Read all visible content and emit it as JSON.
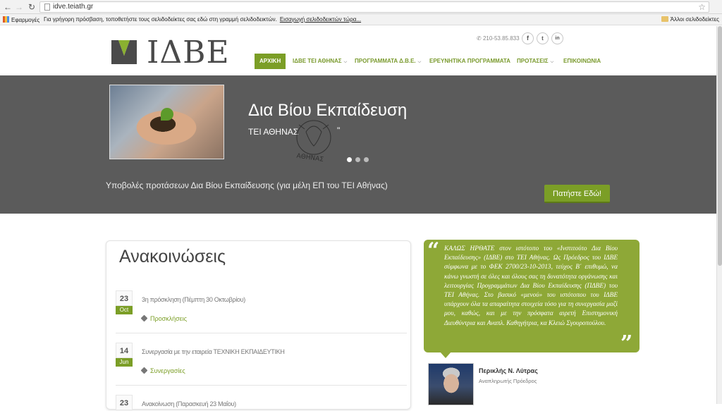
{
  "browser": {
    "url": "idve.teiath.gr",
    "bookmarks_apps_label": "Εφαρμογές",
    "bookmarks_hint": "Για γρήγορη πρόσβαση, τοποθετήστε τους σελιδοδείκτες σας εδώ στη γραμμή σελιδοδεικτών.",
    "bookmarks_import_link": "Εισαγωγή σελιδοδεικτών τώρα...",
    "other_bookmarks": "Άλλοι σελιδοδείκτες"
  },
  "header": {
    "logo_text": "ΙΔΒΕ",
    "phone": "210-53.85.833",
    "social": [
      "f",
      "t",
      "in"
    ],
    "menu": [
      {
        "label": "ΑΡΧΙΚΗ",
        "active": true
      },
      {
        "label": "ΙΔΒΕ ΤΕΙ ΑΘΗΝΑΣ",
        "has_dropdown": true
      },
      {
        "label": "ΠΡΟΓΡΑΜΜΑΤΑ Δ.Β.Ε.",
        "has_dropdown": true
      },
      {
        "label": "ΕΡΕΥΝΗΤΙΚΑ ΠΡΟΓΡΑΜΜΑΤΑ"
      },
      {
        "label": "ΠΡΟΤΑΣΕΙΣ",
        "has_dropdown": true
      },
      {
        "label": "ΕΠΙΚΟΙΝΩΝΙΑ"
      }
    ]
  },
  "hero": {
    "title": "Δια Βίου Εκπαίδευση",
    "subtitle": "ΤΕΙ ΑΘΗΝΑΣ",
    "quote_mark": "\"",
    "seal_text": "ΑΘΗΝΑΣ",
    "slide_count": 3,
    "active_slide": 1,
    "cta_text": "Υποβολές προτάσεων Δια Βίου Εκπαίδευσης (για μέλη ΕΠ του ΤΕΙ Αθήνας)",
    "cta_button": "Πατήστε Εδώ!"
  },
  "announcements": {
    "title": "Ανακοινώσεις",
    "items": [
      {
        "day": "23",
        "month": "Oct",
        "text": "3η πρόσκληση (Πέμπτη 30 Οκτωβρίου)",
        "tag": "Προσκλήσεις"
      },
      {
        "day": "14",
        "month": "Jun",
        "text": "Συνεργασία με την εταιρεία ΤΕΧΝΙΚΗ ΕΚΠΑΙΔΕΥΤΙΚΗ",
        "tag": "Συνεργασίες"
      },
      {
        "day": "23",
        "month": "",
        "text": "Ανακοίνωση (Παρασκευή 23 Μαΐου)",
        "tag": ""
      }
    ]
  },
  "welcome": {
    "text": "ΚΑΛΩΣ ΗΡΘΑΤΕ στον ιστότοπο του «Ινστιτούτο Δια Βίου Εκπαίδευσης» (ΙΔΒΕ) στο ΤΕΙ Αθήνας. Ως Πρόεδρος του ΙΔΒΕ σύμφωνα με το ΦΕΚ 2700/23-10-2013, τεύχος Β΄ επιθυμώ, να κάνω γνωστή σε όλες και όλους σας τη δυνατότητα οργάνωσης και λειτουργίας Προγραμμάτων Δια Βίου Εκπαίδευσης (ΠΔΒΕ) του ΤΕΙ Αθήνας. Στο βασικό «μενού» του ιστότοπου του ΙΔΒΕ υπάρχουν όλα τα απαραίτητα στοιχεία τόσο για τη συνεργασία μαζί μου, καθώς, και με την πρόσφατα αιρετή Επιστημονική Διευθύντρια και Αναπλ. Καθηγήτρια, κα Κλειώ Σγουροπούλου.",
    "open_quote": "“",
    "close_quote": "”",
    "person_name": "Περικλής Ν. Λύτρας",
    "person_role": "Αναπληρωτής Πρόεδρος"
  },
  "colors": {
    "accent": "#7b9e26",
    "hero_bg": "#5b5b5b",
    "quote_bg": "#8ea837"
  }
}
